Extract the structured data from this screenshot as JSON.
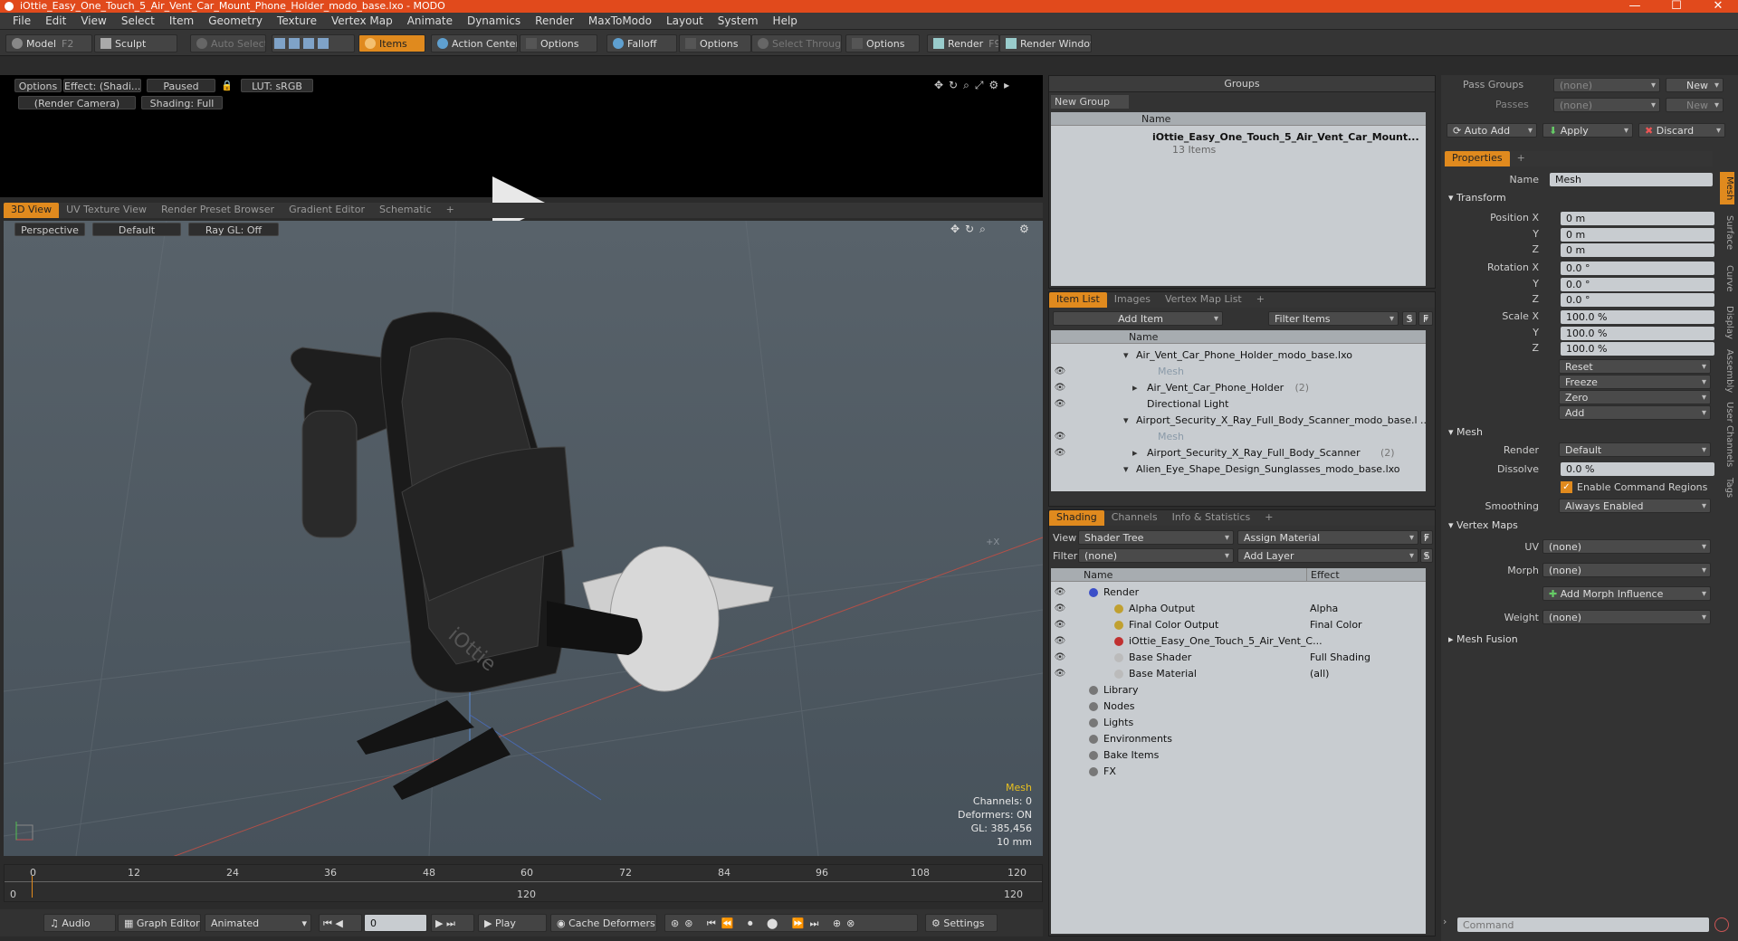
{
  "window": {
    "title": "iOttie_Easy_One_Touch_5_Air_Vent_Car_Mount_Phone_Holder_modo_base.lxo - MODO",
    "min": "—",
    "max": "☐",
    "close": "✕"
  },
  "menu": [
    "File",
    "Edit",
    "View",
    "Select",
    "Item",
    "Geometry",
    "Texture",
    "Vertex Map",
    "Animate",
    "Dynamics",
    "Render",
    "MaxToModo",
    "Layout",
    "System",
    "Help"
  ],
  "toolbar": {
    "model": "Model",
    "model_hotkey": "F2",
    "sculpt": "Sculpt",
    "auto_select": "Auto Select",
    "items": "Items",
    "action_center": "Action Center",
    "options1": "Options",
    "falloff": "Falloff",
    "options2": "Options",
    "select_through": "Select Through",
    "options3": "Options",
    "render": "Render",
    "render_hotkey": "F9",
    "render_window": "Render Window"
  },
  "preview": {
    "options": "Options",
    "effect": "Effect: (Shadi...",
    "paused": "Paused",
    "lut": "LUT: sRGB",
    "camera": "(Render Camera)",
    "shading": "Shading: Full"
  },
  "viewtabs": [
    "3D View",
    "UV Texture View",
    "Render Preset Browser",
    "Gradient Editor",
    "Schematic",
    "+"
  ],
  "viewport": {
    "perspective": "Perspective",
    "default": "Default",
    "raygl": "Ray GL: Off",
    "hud_type": "Mesh",
    "channels": "Channels: 0",
    "deformers": "Deformers: ON",
    "gl": "GL: 385,456",
    "unit": "10 mm",
    "axis_label": "+X",
    "brand": "iOttie"
  },
  "timeline": {
    "ticks": [
      "0",
      "12",
      "24",
      "36",
      "48",
      "60",
      "72",
      "84",
      "96",
      "108",
      "120"
    ],
    "lower": [
      "0",
      "120",
      "120"
    ]
  },
  "bottom": {
    "audio": "Audio",
    "graph_editor": "Graph Editor",
    "animated": "Animated",
    "frame": "0",
    "play": "Play",
    "cache": "Cache Deformers",
    "settings": "Settings"
  },
  "groups": {
    "title": "Groups",
    "new_group": "New Group",
    "col_name": "Name",
    "item_name": "iOttie_Easy_One_Touch_5_Air_Vent_Car_Mount...",
    "item_count": "13 Items"
  },
  "itemlist": {
    "tabs": [
      "Item List",
      "Images",
      "Vertex Map List",
      "+"
    ],
    "add_item": "Add Item",
    "filter": "Filter Items",
    "s": "S",
    "f": "F",
    "col_name": "Name",
    "rows": [
      {
        "label": "Air_Vent_Car_Phone_Holder_modo_base.lxo",
        "indent": 0,
        "dim": false
      },
      {
        "label": "Mesh",
        "indent": 2,
        "dim": true
      },
      {
        "label": "Air_Vent_Car_Phone_Holder",
        "suffix": "(2)",
        "indent": 1,
        "dim": false
      },
      {
        "label": "Directional Light",
        "indent": 1,
        "dim": false
      },
      {
        "label": "Airport_Security_X_Ray_Full_Body_Scanner_modo_base.l ...",
        "indent": 0,
        "dim": false
      },
      {
        "label": "Mesh",
        "indent": 2,
        "dim": true
      },
      {
        "label": "Airport_Security_X_Ray_Full_Body_Scanner",
        "suffix": "(2)",
        "indent": 1,
        "dim": false
      },
      {
        "label": "Alien_Eye_Shape_Design_Sunglasses_modo_base.lxo",
        "indent": 0,
        "dim": false
      }
    ]
  },
  "shading": {
    "tabs": [
      "Shading",
      "Channels",
      "Info & Statistics",
      "+"
    ],
    "view_label": "View",
    "view_value": "Shader Tree",
    "assign": "Assign Material",
    "f": "F",
    "filter_label": "Filter",
    "filter_value": "(none)",
    "add_layer": "Add Layer",
    "s": "S",
    "col_name": "Name",
    "col_effect": "Effect",
    "rows": [
      {
        "label": "Render",
        "effect": "",
        "indent": 0
      },
      {
        "label": "Alpha Output",
        "effect": "Alpha",
        "indent": 1
      },
      {
        "label": "Final Color Output",
        "effect": "Final Color",
        "indent": 1
      },
      {
        "label": "iOttie_Easy_One_Touch_5_Air_Vent_C...",
        "effect": "",
        "indent": 1
      },
      {
        "label": "Base Shader",
        "effect": "Full Shading",
        "indent": 1
      },
      {
        "label": "Base Material",
        "effect": "(all)",
        "indent": 1
      },
      {
        "label": "Library",
        "effect": "",
        "indent": 0
      },
      {
        "label": "Nodes",
        "effect": "",
        "indent": 0
      },
      {
        "label": "Lights",
        "effect": "",
        "indent": 0
      },
      {
        "label": "Environments",
        "effect": "",
        "indent": 0
      },
      {
        "label": "Bake Items",
        "effect": "",
        "indent": 0
      },
      {
        "label": "FX",
        "effect": "",
        "indent": 0
      }
    ]
  },
  "passes": {
    "pass_groups": "Pass Groups",
    "none1": "(none)",
    "new1": "New",
    "passes": "Passes",
    "none2": "(none)",
    "new2": "New",
    "auto_add": "Auto Add",
    "apply": "Apply",
    "discard": "Discard"
  },
  "properties": {
    "tab": "Properties",
    "plus": "+",
    "name_label": "Name",
    "name_value": "Mesh",
    "transform": "Transform",
    "pos_label": "Position X",
    "y": "Y",
    "z": "Z",
    "rot_label": "Rotation X",
    "scale_label": "Scale X",
    "pos": [
      "0 m",
      "0 m",
      "0 m"
    ],
    "rot": [
      "0.0 °",
      "0.0 °",
      "0.0 °"
    ],
    "scale": [
      "100.0 %",
      "100.0 %",
      "100.0 %"
    ],
    "reset": "Reset",
    "freeze": "Freeze",
    "zero": "Zero",
    "add": "Add",
    "mesh": "Mesh",
    "render_label": "Render",
    "render_value": "Default",
    "dissolve_label": "Dissolve",
    "dissolve_value": "0.0 %",
    "enable_cmd": "Enable Command Regions",
    "smoothing_label": "Smoothing",
    "smoothing_value": "Always Enabled",
    "vertex_maps": "Vertex Maps",
    "uv_label": "UV",
    "uv_value": "(none)",
    "morph_label": "Morph",
    "morph_value": "(none)",
    "add_morph": "Add Morph Influence",
    "weight_label": "Weight",
    "weight_value": "(none)",
    "mesh_fusion": "Mesh Fusion",
    "side_tabs": [
      "Mesh",
      "Surface",
      "Curve",
      "Display",
      "Assembly",
      "User Channels",
      "Tags"
    ]
  },
  "command": {
    "placeholder": "Command"
  }
}
